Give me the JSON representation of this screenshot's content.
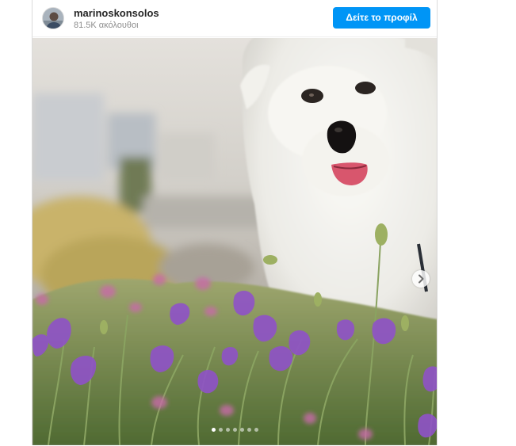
{
  "header": {
    "username": "marinoskonsolos",
    "followers": "81.5K ακόλουθοι",
    "profile_button_label": "Δείτε το προφίλ"
  },
  "carousel": {
    "slide_count": 7,
    "active_index": 0,
    "next_icon": "chevron-right-icon"
  },
  "colors": {
    "accent": "#0095f6",
    "text_primary": "#262626",
    "text_secondary": "#8e8e8e",
    "border": "#dbdbdb"
  }
}
